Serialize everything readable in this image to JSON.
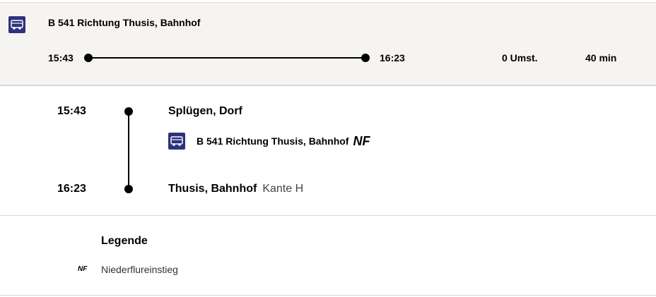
{
  "summary": {
    "line_icon": "bus-icon",
    "route": "B 541 Richtung Thusis, Bahnhof",
    "departure": "15:43",
    "arrival": "16:23",
    "changes": "0 Umst.",
    "duration": "40 min"
  },
  "detail": {
    "origin": {
      "time": "15:43",
      "name": "Splügen, Dorf"
    },
    "leg": {
      "line_icon": "bus-icon",
      "route": "B 541 Richtung Thusis, Bahnhof",
      "badge": "NF"
    },
    "destination": {
      "time": "16:23",
      "name": "Thusis, Bahnhof",
      "platform": "Kante H"
    }
  },
  "legend": {
    "title": "Legende",
    "items": [
      {
        "code": "NF",
        "description": "Niederflureinstieg"
      }
    ]
  },
  "colors": {
    "bus_icon_bg": "#2d327d",
    "summary_bg": "#f6f4f1"
  }
}
